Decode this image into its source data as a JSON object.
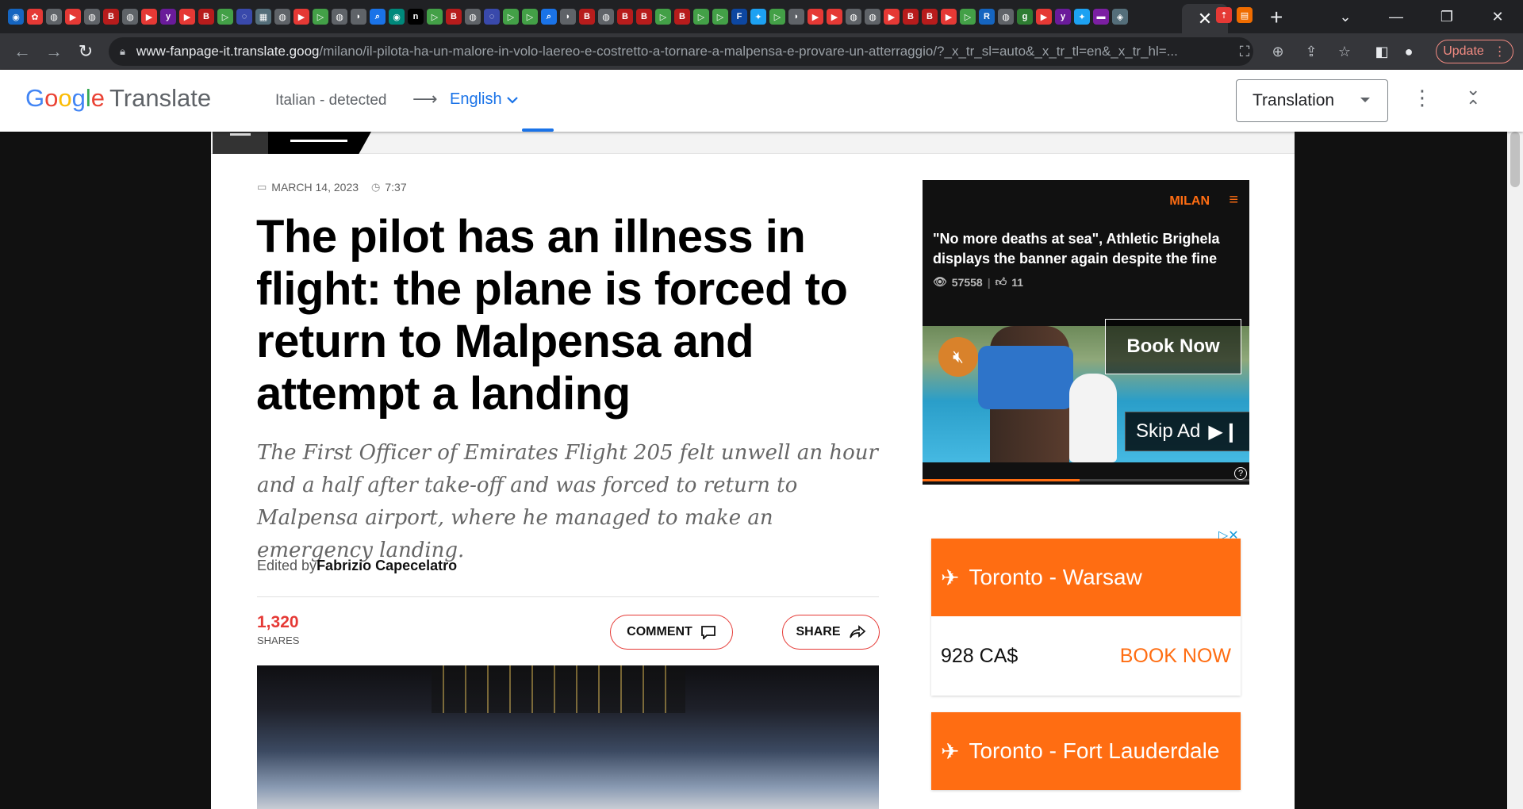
{
  "browser": {
    "active_tab_close": "✕",
    "new_tab": "+",
    "url_host": "www-fanpage-it.translate.goog",
    "url_path": "/milano/il-pilota-ha-un-malore-in-volo-laereo-e-costretto-a-tornare-a-malpensa-e-provare-un-atterraggio/?_x_tr_sl=auto&_x_tr_tl=en&_x_tr_hl=...",
    "update_label": "Update",
    "favicons": [
      {
        "c": "#1565c0",
        "t": "◉"
      },
      {
        "c": "#e53935",
        "t": "✿"
      },
      {
        "c": "#5f6368",
        "t": "◍"
      },
      {
        "c": "#e53935",
        "t": "▶"
      },
      {
        "c": "#5f6368",
        "t": "◍"
      },
      {
        "c": "#b71c1c",
        "t": "B"
      },
      {
        "c": "#5f6368",
        "t": "◍"
      },
      {
        "c": "#e53935",
        "t": "▶"
      },
      {
        "c": "#6a1b9a",
        "t": "y"
      },
      {
        "c": "#e53935",
        "t": "▶"
      },
      {
        "c": "#b71c1c",
        "t": "B"
      },
      {
        "c": "#43a047",
        "t": "▷"
      },
      {
        "c": "#3949ab",
        "t": "◌"
      },
      {
        "c": "#546e7a",
        "t": "▦"
      },
      {
        "c": "#5f6368",
        "t": "◍"
      },
      {
        "c": "#e53935",
        "t": "▶"
      },
      {
        "c": "#43a047",
        "t": "▷"
      },
      {
        "c": "#5f6368",
        "t": "◍"
      },
      {
        "c": "#5f6368",
        "t": "◗"
      },
      {
        "c": "#1a73e8",
        "t": "⌕"
      },
      {
        "c": "#00897b",
        "t": "◉"
      },
      {
        "c": "#000000",
        "t": "n"
      },
      {
        "c": "#43a047",
        "t": "▷"
      },
      {
        "c": "#b71c1c",
        "t": "B"
      },
      {
        "c": "#5f6368",
        "t": "◍"
      },
      {
        "c": "#3949ab",
        "t": "◌"
      },
      {
        "c": "#43a047",
        "t": "▷"
      },
      {
        "c": "#43a047",
        "t": "▷"
      },
      {
        "c": "#1a73e8",
        "t": "⌕"
      },
      {
        "c": "#5f6368",
        "t": "◗"
      },
      {
        "c": "#b71c1c",
        "t": "B"
      },
      {
        "c": "#5f6368",
        "t": "◍"
      },
      {
        "c": "#b71c1c",
        "t": "B"
      },
      {
        "c": "#b71c1c",
        "t": "B"
      },
      {
        "c": "#43a047",
        "t": "▷"
      },
      {
        "c": "#b71c1c",
        "t": "B"
      },
      {
        "c": "#43a047",
        "t": "▷"
      },
      {
        "c": "#43a047",
        "t": "▷"
      },
      {
        "c": "#0d47a1",
        "t": "F"
      },
      {
        "c": "#1da1f2",
        "t": "✦"
      },
      {
        "c": "#43a047",
        "t": "▷"
      },
      {
        "c": "#5f6368",
        "t": "◗"
      },
      {
        "c": "#e53935",
        "t": "▶"
      },
      {
        "c": "#e53935",
        "t": "▶"
      },
      {
        "c": "#5f6368",
        "t": "◍"
      },
      {
        "c": "#5f6368",
        "t": "◍"
      },
      {
        "c": "#e53935",
        "t": "▶"
      },
      {
        "c": "#b71c1c",
        "t": "B"
      },
      {
        "c": "#b71c1c",
        "t": "B"
      },
      {
        "c": "#e53935",
        "t": "▶"
      },
      {
        "c": "#43a047",
        "t": "▷"
      },
      {
        "c": "#1565c0",
        "t": "R"
      },
      {
        "c": "#5f6368",
        "t": "◍"
      },
      {
        "c": "#2e7d32",
        "t": "g"
      },
      {
        "c": "#e53935",
        "t": "▶"
      },
      {
        "c": "#6a1b9a",
        "t": "y"
      },
      {
        "c": "#1da1f2",
        "t": "✦"
      },
      {
        "c": "#7b1fa2",
        "t": "▬"
      },
      {
        "c": "#546e7a",
        "t": "◈"
      }
    ],
    "extra_favicons": [
      {
        "c": "#e53935",
        "t": "⇡"
      },
      {
        "c": "#ef6c00",
        "t": "▤"
      }
    ]
  },
  "translate_bar": {
    "logo_parts": [
      "G",
      "o",
      "o",
      "g",
      "l",
      "e"
    ],
    "logo_suffix": "Translate",
    "source_lang": "Italian - detected",
    "arrow": "⟶",
    "target_lang": "English",
    "mode": "Translation"
  },
  "article": {
    "date": "MARCH 14, 2023",
    "time": "7:37",
    "headline": "The pilot has an illness in flight: the plane is forced to return to Malpensa and attempt a landing",
    "subheadline": "The First Officer of Emirates Flight 205 felt unwell an hour and a half after take-off and was forced to return to Malpensa airport, where he managed to make an emergency landing.",
    "byline_prefix": "Edited by",
    "author": "Fabrizio Capecelatro",
    "shares_count": "1,320",
    "shares_label": "SHARES",
    "comment_label": "COMMENT",
    "share_label": "SHARE"
  },
  "video_ad": {
    "category": "MILAN",
    "title": "\"No more deaths at sea\", Athletic Brighela displays the banner again despite the fine",
    "views": "57558",
    "likes": "11",
    "book_now": "Book Now",
    "skip_ad": "Skip Ad",
    "help": "?",
    "progress_fraction": 0.48
  },
  "flight_ads": [
    {
      "route": "Toronto - Warsaw",
      "price": "928 CA$",
      "cta": "BOOK NOW"
    },
    {
      "route": "Toronto - Fort Lauderdale"
    }
  ],
  "colors": {
    "accent_orange": "#ff6d12",
    "share_red": "#e53935",
    "translate_blue": "#1a73e8"
  }
}
